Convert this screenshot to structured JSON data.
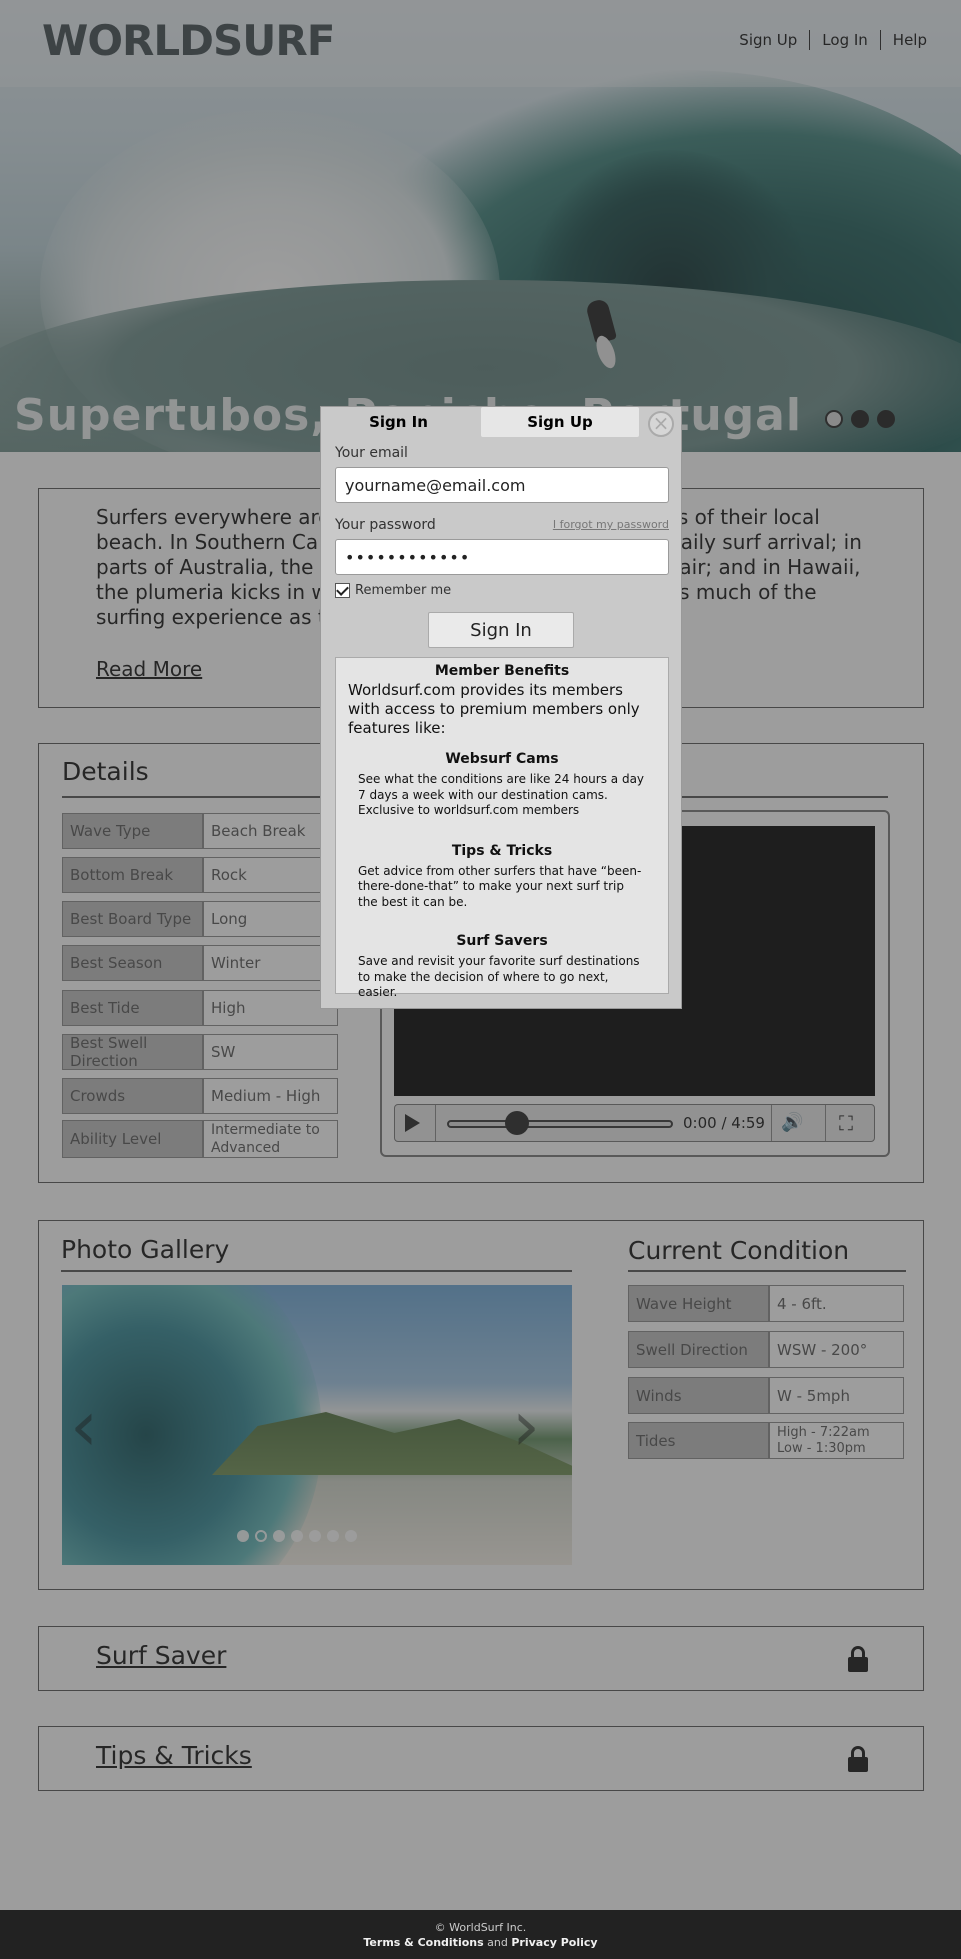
{
  "header": {
    "logo": "WORLDSURF",
    "nav": [
      "Sign Up",
      "Log In",
      "Help"
    ]
  },
  "hero": {
    "caption": "Supertubos, Peniche, Portugal",
    "slides": 3,
    "active_slide": 1
  },
  "intro": {
    "text": "Surfers everywhere are familiar with the sights and sounds of their local beach. In Southern California, drivers sit in traffic for the daily surf arrival; in parts of Australia, the smell of coconut sunscreen fills the air; and in Hawaii, the plumeria kicks in with the trade winds. Each place is as much of the surfing experience as the waves.",
    "read_more": "Read More"
  },
  "details": {
    "title": "Details",
    "rows": [
      {
        "label": "Wave Type",
        "value": "Beach Break"
      },
      {
        "label": "Bottom Break",
        "value": "Rock"
      },
      {
        "label": "Best Board Type",
        "value": "Long"
      },
      {
        "label": "Best Season",
        "value": "Winter"
      },
      {
        "label": "Best Tide",
        "value": "High"
      },
      {
        "label": "Best Swell Direction",
        "value": "SW"
      },
      {
        "label": "Crowds",
        "value": "Medium - High"
      },
      {
        "label": "Ability Level",
        "value": "Intermediate to Advanced"
      }
    ]
  },
  "video": {
    "time": "0:00 / 4:59",
    "progress": 0.3
  },
  "gallery": {
    "title": "Photo Gallery",
    "dots": 7,
    "active_dot": 2
  },
  "conditions": {
    "title": "Current Condition",
    "rows": [
      {
        "label": "Wave Height",
        "value": "4 - 6ft."
      },
      {
        "label": "Swell Direction",
        "value": "WSW - 200°"
      },
      {
        "label": "Winds",
        "value": "W - 5mph"
      },
      {
        "label": "Tides",
        "value": "High - 7:22am Low - 1:30pm"
      }
    ]
  },
  "surf_saver": "Surf Saver",
  "tips_tricks": "Tips & Tricks",
  "footer": {
    "copyright": "© WorldSurf Inc.",
    "terms": "Terms & Conditions",
    "and": "and",
    "privacy": "Privacy Policy"
  },
  "modal": {
    "tab_signin": "Sign In",
    "tab_signup": "Sign Up",
    "close": "×",
    "email_label": "Your email",
    "email_value": "yourname@email.com",
    "password_label": "Your password",
    "forgot": "I forgot my password",
    "password_value": "••••••••••••",
    "remember": "Remember me",
    "signin_button": "Sign In",
    "benefits": {
      "title": "Member Benefits",
      "intro": "Worldsurf.com provides its members with access to premium members only features like:",
      "items": [
        {
          "title": "Websurf Cams",
          "desc": "See what the conditions are like 24 hours a day 7 days a week with our destination cams. Exclusive to worldsurf.com members"
        },
        {
          "title": "Tips & Tricks",
          "desc": "Get advice from other surfers that have “been-there-done-that” to make your next surf trip the best it can be."
        },
        {
          "title": "Surf Savers",
          "desc": "Save and revisit your favorite surf destinations to make the decision of where to go next, easier."
        }
      ]
    }
  }
}
